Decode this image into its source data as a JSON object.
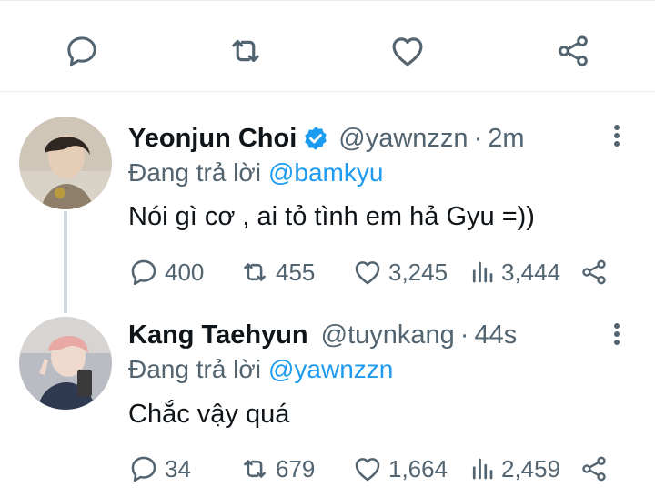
{
  "action_bar": {
    "items": [
      {
        "icon": "reply-icon"
      },
      {
        "icon": "retweet-icon"
      },
      {
        "icon": "like-icon"
      },
      {
        "icon": "share-icon"
      }
    ]
  },
  "tweets": [
    {
      "name": "Yeonjun Choi",
      "verified": true,
      "handle": "@yawnzzn",
      "dot": "·",
      "time": "2m",
      "reply_prefix": "Đang trả lời",
      "reply_to": "@bamkyu",
      "text": "Nói gì cơ , ai tỏ tình em hả Gyu =))",
      "stats": {
        "replies": "400",
        "retweets": "455",
        "likes": "3,245",
        "views": "3,444"
      }
    },
    {
      "name": "Kang Taehyun",
      "verified": false,
      "handle": "@tuynkang",
      "dot": "·",
      "time": "44s",
      "reply_prefix": "Đang trả lời",
      "reply_to": "@yawnzzn",
      "text": "Chắc vậy quá",
      "stats": {
        "replies": "34",
        "retweets": "679",
        "likes": "1,664",
        "views": "2,459"
      }
    }
  ],
  "colors": {
    "accent": "#1d9bf0",
    "muted": "#536471",
    "text": "#0f1419",
    "divider": "#e7e9ea"
  }
}
